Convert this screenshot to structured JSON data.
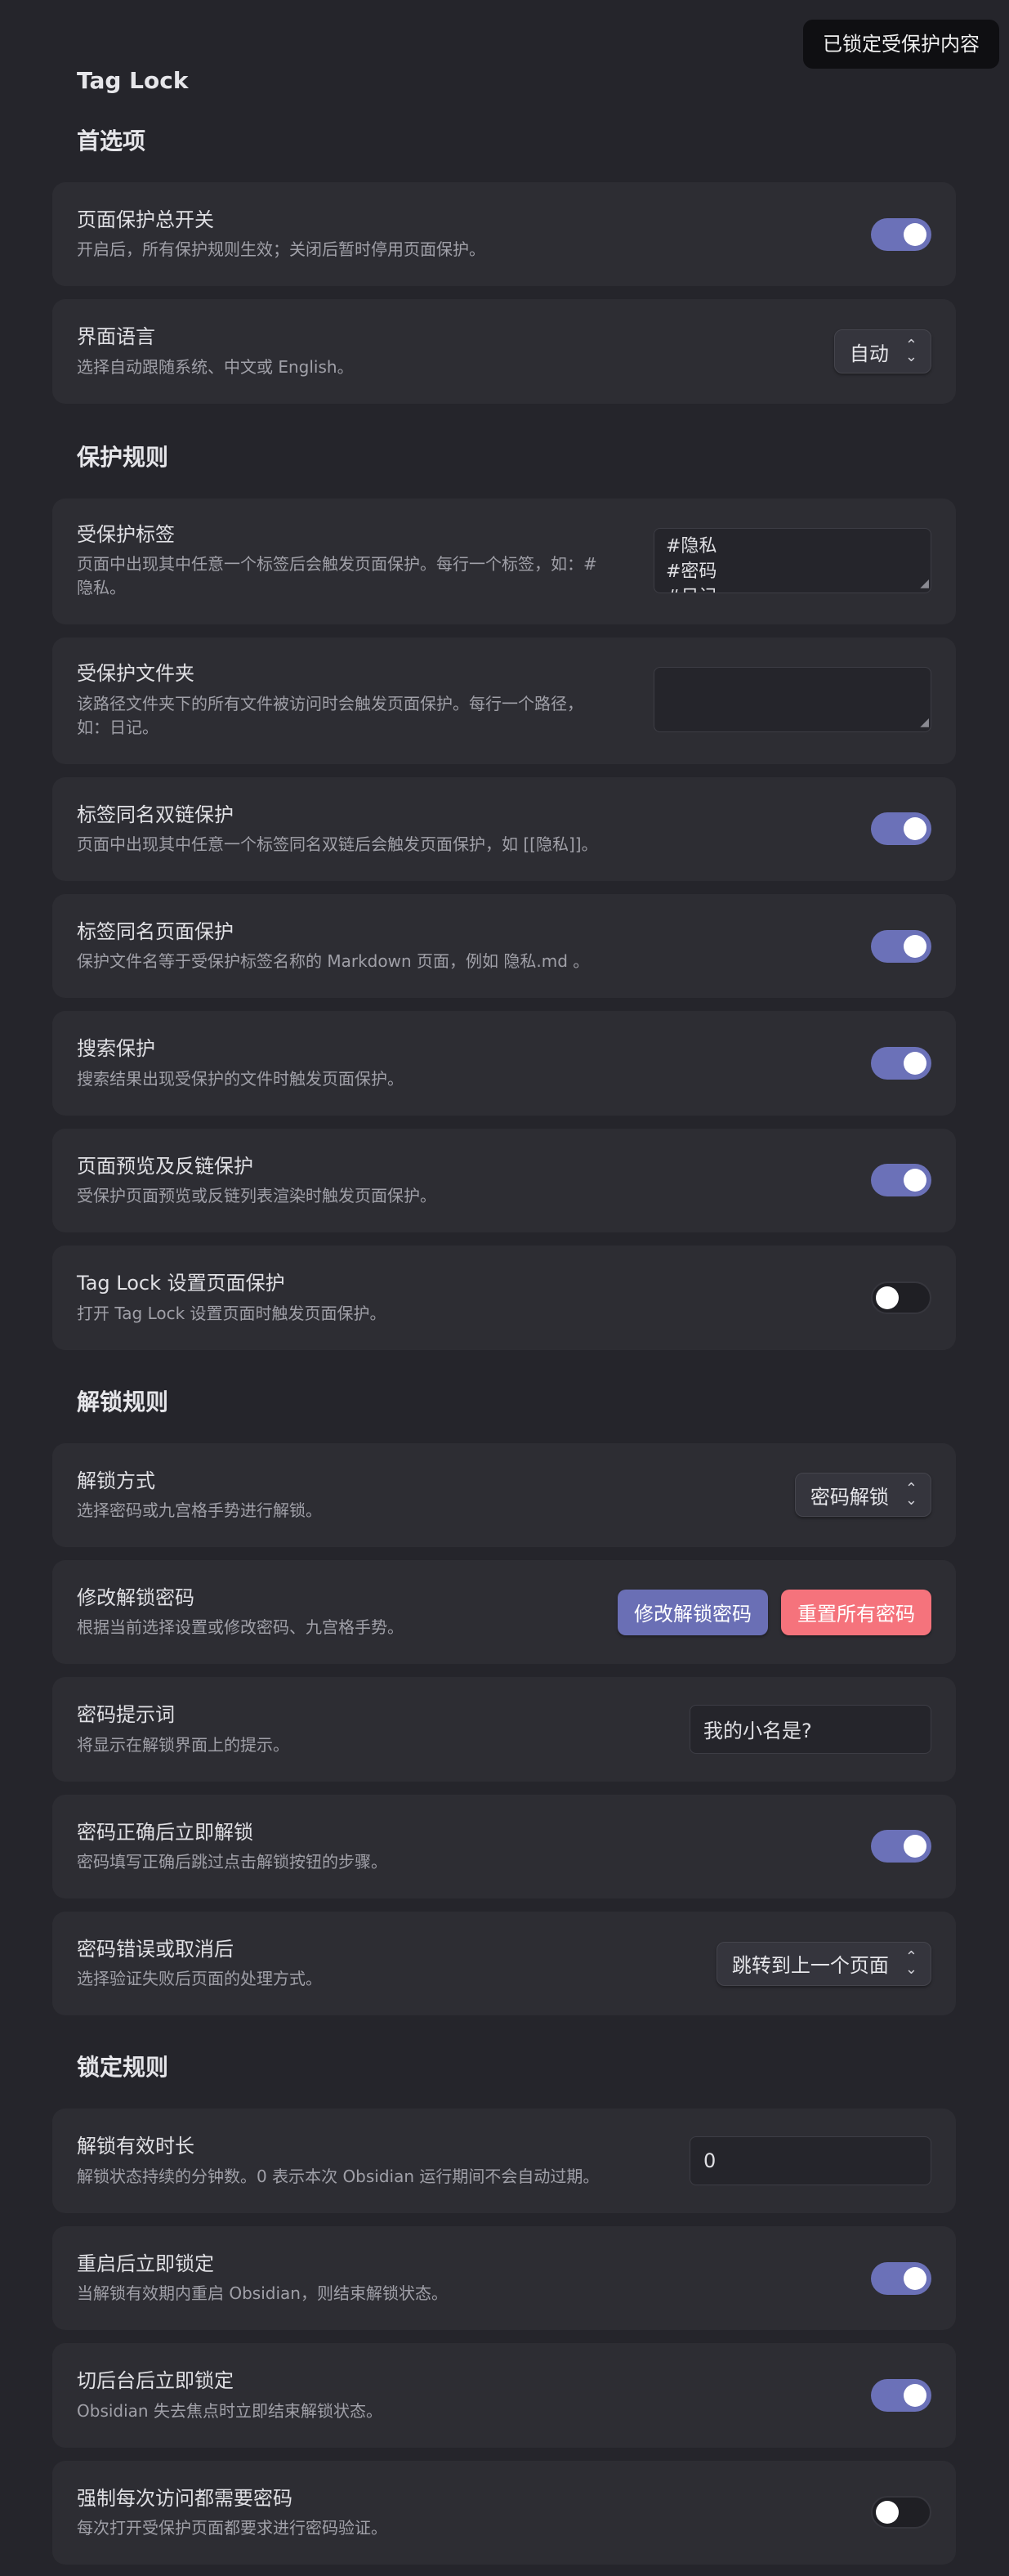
{
  "tooltip": "已锁定受保护内容",
  "app_title": "Tag Lock",
  "sections": {
    "prefs": "首选项",
    "protect": "保护规则",
    "unlock": "解锁规则",
    "lock": "锁定规则"
  },
  "settings": {
    "master": {
      "name": "页面保护总开关",
      "desc": "开启后，所有保护规则生效；关闭后暂时停用页面保护。",
      "enabled": true
    },
    "language": {
      "name": "界面语言",
      "desc": "选择自动跟随系统、中文或 English。",
      "value": "自动"
    },
    "tags": {
      "name": "受保护标签",
      "desc": "页面中出现其中任意一个标签后会触发页面保护。每行一个标签，如：#隐私。",
      "lines": [
        "#隐私",
        "#密码",
        "#日记"
      ]
    },
    "folders": {
      "name": "受保护文件夹",
      "desc": "该路径文件夹下的所有文件被访问时会触发页面保护。每行一个路径，如：日记。",
      "value": ""
    },
    "backlink": {
      "name": "标签同名双链保护",
      "desc": "页面中出现其中任意一个标签同名双链后会触发页面保护，如 [[隐私]]。",
      "enabled": true
    },
    "same_name_page": {
      "name": "标签同名页面保护",
      "desc": "保护文件名等于受保护标签名称的 Markdown 页面，例如 隐私.md 。",
      "enabled": true
    },
    "search": {
      "name": "搜索保护",
      "desc": "搜索结果出现受保护的文件时触发页面保护。",
      "enabled": true
    },
    "preview": {
      "name": "页面预览及反链保护",
      "desc": "受保护页面预览或反链列表渲染时触发页面保护。",
      "enabled": true
    },
    "settings_page": {
      "name": "Tag Lock 设置页面保护",
      "desc": "打开 Tag Lock 设置页面时触发页面保护。",
      "enabled": false
    },
    "unlock_method": {
      "name": "解锁方式",
      "desc": "选择密码或九宫格手势进行解锁。",
      "value": "密码解锁"
    },
    "change_password": {
      "name": "修改解锁密码",
      "desc": "根据当前选择设置或修改密码、九宫格手势。",
      "primary_btn": "修改解锁密码",
      "danger_btn": "重置所有密码"
    },
    "hint": {
      "name": "密码提示词",
      "desc": "将显示在解锁界面上的提示。",
      "value": "我的小名是?"
    },
    "auto_unlock": {
      "name": "密码正确后立即解锁",
      "desc": "密码填写正确后跳过点击解锁按钮的步骤。",
      "enabled": true
    },
    "on_fail": {
      "name": "密码错误或取消后",
      "desc": "选择验证失败后页面的处理方式。",
      "value": "跳转到上一个页面"
    },
    "duration": {
      "name": "解锁有效时长",
      "desc": "解锁状态持续的分钟数。0 表示本次 Obsidian 运行期间不会自动过期。",
      "value": "0"
    },
    "relock_restart": {
      "name": "重启后立即锁定",
      "desc": "当解锁有效期内重启 Obsidian，则结束解锁状态。",
      "enabled": true
    },
    "relock_blur": {
      "name": "切后台后立即锁定",
      "desc": "Obsidian 失去焦点时立即结束解锁状态。",
      "enabled": true
    },
    "always_require": {
      "name": "强制每次访问都需要密码",
      "desc": "每次打开受保护页面都要求进行密码验证。",
      "enabled": false
    }
  },
  "icons": {
    "chevron": "chevron-up-down-icon",
    "resize": "resize-handle-icon"
  },
  "colors": {
    "accent": "#6b71b8",
    "danger": "#f5737c",
    "background": "#25252b",
    "card": "#2d2d33"
  }
}
